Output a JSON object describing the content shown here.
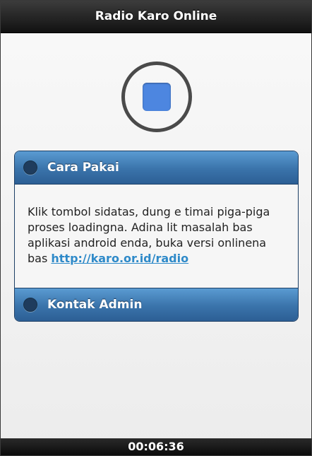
{
  "header": {
    "title": "Radio Karo Online"
  },
  "player": {
    "state_icon": "stop-icon",
    "accent": "#4d86e0"
  },
  "sections": [
    {
      "title": "Cara Pakai",
      "body_text": "Klik tombol sidatas, dung e timai piga-piga proses loadingna. Adina lit masalah bas aplikasi android enda, buka versi onlinena bas ",
      "link_text": "http://karo.or.id/radio"
    },
    {
      "title": "Kontak Admin"
    }
  ],
  "footer": {
    "elapsed": "00:06:36"
  },
  "colors": {
    "header_bg": "#111111",
    "section_header": "#3a73aa",
    "link": "#2f8ac9"
  }
}
